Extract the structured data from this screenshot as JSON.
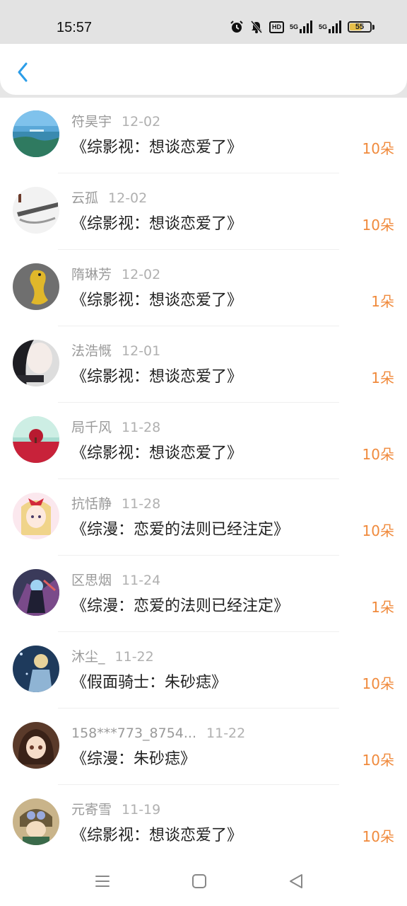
{
  "status_bar": {
    "time": "15:57",
    "icons": [
      "alarm-icon",
      "mute-icon",
      "hd-icon",
      "signal-5g-icon",
      "signal-5g-icon"
    ],
    "hd_label": "HD",
    "net1_label": "5G",
    "net2_label": "5G",
    "battery_level": "55"
  },
  "header": {
    "back_icon": "chevron-left-icon",
    "accent": "#2b9de8"
  },
  "colors": {
    "amount": "#f08a3c",
    "name": "#9a9a9a",
    "title": "#222222"
  },
  "records": [
    {
      "name": "符昊宇",
      "date": "12-02",
      "title": "《综影视：想谈恋爱了》",
      "amount": "10朵"
    },
    {
      "name": "云孤",
      "date": "12-02",
      "title": "《综影视：想谈恋爱了》",
      "amount": "10朵"
    },
    {
      "name": "隋琳芳",
      "date": "12-02",
      "title": "《综影视：想谈恋爱了》",
      "amount": "1朵"
    },
    {
      "name": "法浩慨",
      "date": "12-01",
      "title": "《综影视：想谈恋爱了》",
      "amount": "1朵"
    },
    {
      "name": "局千风",
      "date": "11-28",
      "title": "《综影视：想谈恋爱了》",
      "amount": "10朵"
    },
    {
      "name": "抗恬静",
      "date": "11-28",
      "title": "《综漫：恋爱的法则已经注定》",
      "amount": "10朵"
    },
    {
      "name": "区思烟",
      "date": "11-24",
      "title": "《综漫：恋爱的法则已经注定》",
      "amount": "1朵"
    },
    {
      "name": "沐尘_",
      "date": "11-22",
      "title": "《假面骑士：朱砂痣》",
      "amount": "10朵"
    },
    {
      "name": "158***773_8754...",
      "date": "11-22",
      "title": "《综漫：朱砂痣》",
      "amount": "10朵"
    },
    {
      "name": "元寄雪",
      "date": "11-19",
      "title": "《综影视：想谈恋爱了》",
      "amount": "10朵"
    }
  ],
  "nav_bar": {
    "icons": [
      "menu-icon",
      "home-square-icon",
      "back-triangle-icon"
    ]
  }
}
